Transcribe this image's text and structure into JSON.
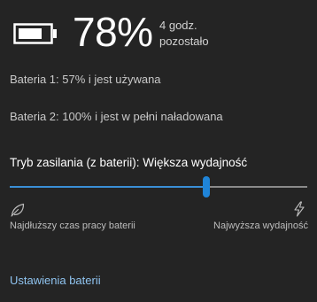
{
  "header": {
    "battery_icon": "battery-icon",
    "percent": "78%",
    "remaining_line1": "4 godz.",
    "remaining_line2": "pozostało"
  },
  "batteries": [
    {
      "text": "Bateria 1: 57% i jest używana"
    },
    {
      "text": "Bateria 2: 100% i jest w pełni naładowana"
    }
  ],
  "power_mode": {
    "label": "Tryb zasilania (z baterii): Większa wydajność",
    "slider_fraction": 0.66,
    "left_icon": "leaf-icon",
    "right_icon": "bolt-icon",
    "left_label": "Najdłuższy czas pracy baterii",
    "right_label": "Najwyższa wydajność"
  },
  "settings_link": "Ustawienia baterii",
  "colors": {
    "background": "#242424",
    "accent": "#1f84d8",
    "link": "#8fc3ef"
  }
}
